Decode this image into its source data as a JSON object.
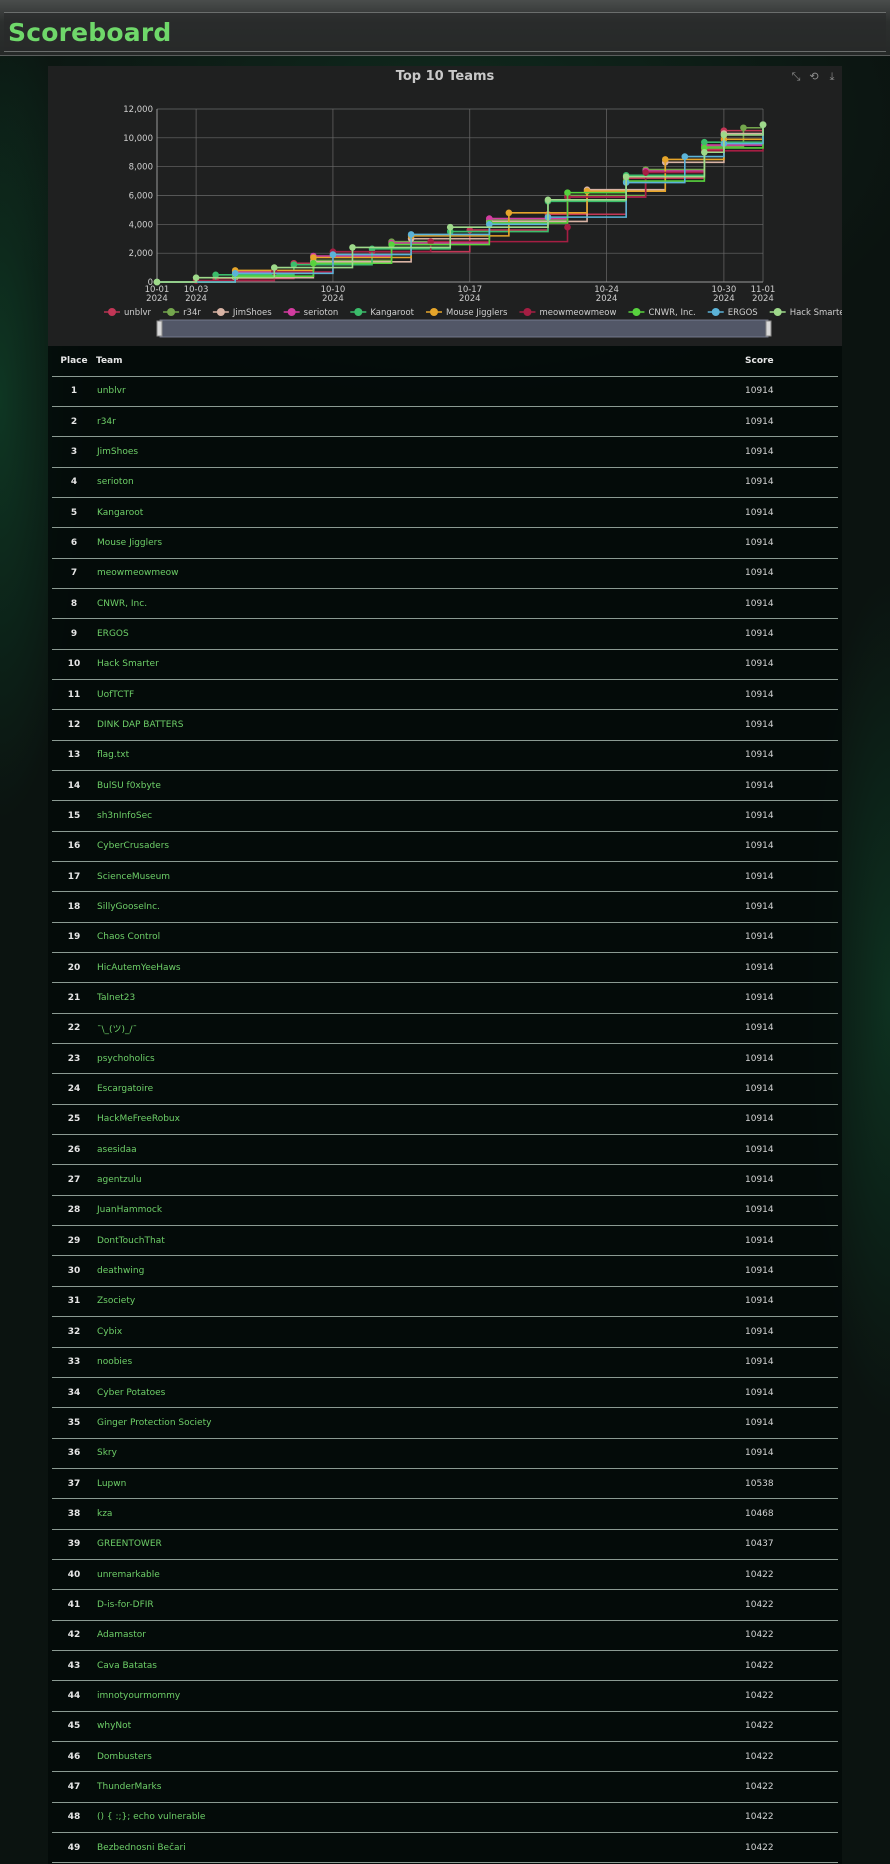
{
  "page": {
    "title": "Scoreboard"
  },
  "chart": {
    "title": "Top 10 Teams",
    "toolbox": [
      "zoom-icon",
      "zoom-reset-icon",
      "download-icon"
    ]
  },
  "chart_data": {
    "type": "line",
    "title": "Top 10 Teams",
    "xlabel": "",
    "ylabel": "",
    "x_ticks": [
      "10-01 2024",
      "10-03 2024",
      "10-10 2024",
      "10-17 2024",
      "10-24 2024",
      "10-30 2024",
      "11-01 2024"
    ],
    "y_ticks": [
      "0",
      "2,000",
      "4,000",
      "6,000",
      "8,000",
      "10,000",
      "12,000"
    ],
    "xlim": [
      "2024-10-01",
      "2024-11-01"
    ],
    "ylim": [
      0,
      12000
    ],
    "grid": true,
    "legend_position": "bottom",
    "series": [
      {
        "name": "unblvr",
        "color": "#c23656",
        "points": [
          [
            "2024-10-01",
            0
          ],
          [
            "2024-10-04",
            250
          ],
          [
            "2024-10-08",
            1300
          ],
          [
            "2024-10-12",
            2100
          ],
          [
            "2024-10-17",
            3600
          ],
          [
            "2024-10-21",
            4700
          ],
          [
            "2024-10-25",
            7200
          ],
          [
            "2024-10-29",
            9200
          ],
          [
            "2024-10-30",
            10500
          ],
          [
            "2024-11-01",
            10914
          ]
        ]
      },
      {
        "name": "r34r",
        "color": "#74a64d",
        "points": [
          [
            "2024-10-01",
            0
          ],
          [
            "2024-10-05",
            600
          ],
          [
            "2024-10-09",
            1500
          ],
          [
            "2024-10-13",
            2800
          ],
          [
            "2024-10-18",
            4300
          ],
          [
            "2024-10-22",
            6000
          ],
          [
            "2024-10-26",
            7800
          ],
          [
            "2024-10-29",
            9400
          ],
          [
            "2024-10-31",
            10700
          ],
          [
            "2024-11-01",
            10914
          ]
        ]
      },
      {
        "name": "JimShoes",
        "color": "#d8b3a4",
        "points": [
          [
            "2024-10-01",
            0
          ],
          [
            "2024-10-05",
            300
          ],
          [
            "2024-10-09",
            1400
          ],
          [
            "2024-10-14",
            3000
          ],
          [
            "2024-10-18",
            4200
          ],
          [
            "2024-10-23",
            6400
          ],
          [
            "2024-10-27",
            8300
          ],
          [
            "2024-10-30",
            10300
          ],
          [
            "2024-11-01",
            10914
          ]
        ]
      },
      {
        "name": "serioton",
        "color": "#d33ca0",
        "points": [
          [
            "2024-10-01",
            0
          ],
          [
            "2024-10-05",
            700
          ],
          [
            "2024-10-09",
            1800
          ],
          [
            "2024-10-13",
            2700
          ],
          [
            "2024-10-18",
            4400
          ],
          [
            "2024-10-22",
            5900
          ],
          [
            "2024-10-26",
            7700
          ],
          [
            "2024-10-29",
            9500
          ],
          [
            "2024-11-01",
            10914
          ]
        ]
      },
      {
        "name": "Kangaroot",
        "color": "#3bbd6b",
        "points": [
          [
            "2024-10-01",
            0
          ],
          [
            "2024-10-04",
            500
          ],
          [
            "2024-10-08",
            1200
          ],
          [
            "2024-10-12",
            2300
          ],
          [
            "2024-10-16",
            3500
          ],
          [
            "2024-10-21",
            5600
          ],
          [
            "2024-10-25",
            7400
          ],
          [
            "2024-10-29",
            9700
          ],
          [
            "2024-11-01",
            10914
          ]
        ]
      },
      {
        "name": "Mouse Jigglers",
        "color": "#e6a52a",
        "points": [
          [
            "2024-10-01",
            0
          ],
          [
            "2024-10-05",
            800
          ],
          [
            "2024-10-09",
            1700
          ],
          [
            "2024-10-14",
            3200
          ],
          [
            "2024-10-19",
            4800
          ],
          [
            "2024-10-23",
            6300
          ],
          [
            "2024-10-27",
            8500
          ],
          [
            "2024-10-30",
            9900
          ],
          [
            "2024-11-01",
            10914
          ]
        ]
      },
      {
        "name": "meowmeowmeow",
        "color": "#a51e43",
        "points": [
          [
            "2024-10-01",
            0
          ],
          [
            "2024-10-03",
            100
          ],
          [
            "2024-10-07",
            700
          ],
          [
            "2024-10-10",
            2100
          ],
          [
            "2024-10-15",
            2800
          ],
          [
            "2024-10-22",
            3800
          ],
          [
            "2024-10-22",
            5900
          ],
          [
            "2024-10-26",
            7600
          ],
          [
            "2024-10-29",
            9100
          ],
          [
            "2024-11-01",
            10914
          ]
        ]
      },
      {
        "name": "CNWR, Inc.",
        "color": "#58d23e",
        "points": [
          [
            "2024-10-01",
            0
          ],
          [
            "2024-10-05",
            400
          ],
          [
            "2024-10-09",
            1300
          ],
          [
            "2024-10-13",
            2600
          ],
          [
            "2024-10-18",
            4100
          ],
          [
            "2024-10-22",
            6200
          ],
          [
            "2024-10-25",
            7000
          ],
          [
            "2024-10-29",
            9300
          ],
          [
            "2024-11-01",
            10914
          ]
        ]
      },
      {
        "name": "ERGOS",
        "color": "#5bb3d8",
        "points": [
          [
            "2024-10-01",
            0
          ],
          [
            "2024-10-05",
            600
          ],
          [
            "2024-10-10",
            1900
          ],
          [
            "2024-10-14",
            3300
          ],
          [
            "2024-10-18",
            4000
          ],
          [
            "2024-10-21",
            4500
          ],
          [
            "2024-10-25",
            6900
          ],
          [
            "2024-10-28",
            8700
          ],
          [
            "2024-10-30",
            9600
          ],
          [
            "2024-11-01",
            10914
          ]
        ]
      },
      {
        "name": "Hack Smarter",
        "color": "#9ed98a",
        "points": [
          [
            "2024-10-01",
            0
          ],
          [
            "2024-10-03",
            300
          ],
          [
            "2024-10-07",
            1000
          ],
          [
            "2024-10-11",
            2400
          ],
          [
            "2024-10-16",
            3800
          ],
          [
            "2024-10-21",
            5700
          ],
          [
            "2024-10-25",
            7300
          ],
          [
            "2024-10-29",
            9000
          ],
          [
            "2024-10-30",
            10200
          ],
          [
            "2024-11-01",
            10914
          ]
        ]
      }
    ]
  },
  "table": {
    "headers": {
      "place": "Place",
      "team": "Team",
      "score": "Score"
    },
    "rows": [
      {
        "place": "1",
        "team": "unblvr",
        "score": "10914"
      },
      {
        "place": "2",
        "team": "r34r",
        "score": "10914"
      },
      {
        "place": "3",
        "team": "JimShoes",
        "score": "10914"
      },
      {
        "place": "4",
        "team": "serioton",
        "score": "10914"
      },
      {
        "place": "5",
        "team": "Kangaroot",
        "score": "10914"
      },
      {
        "place": "6",
        "team": "Mouse Jigglers",
        "score": "10914"
      },
      {
        "place": "7",
        "team": "meowmeowmeow",
        "score": "10914"
      },
      {
        "place": "8",
        "team": "CNWR, Inc.",
        "score": "10914"
      },
      {
        "place": "9",
        "team": "ERGOS",
        "score": "10914"
      },
      {
        "place": "10",
        "team": "Hack Smarter",
        "score": "10914"
      },
      {
        "place": "11",
        "team": "UofTCTF",
        "score": "10914"
      },
      {
        "place": "12",
        "team": "DINK DAP BATTERS",
        "score": "10914"
      },
      {
        "place": "13",
        "team": "flag.txt",
        "score": "10914"
      },
      {
        "place": "14",
        "team": "BulSU f0xbyte",
        "score": "10914"
      },
      {
        "place": "15",
        "team": "sh3nInfoSec",
        "score": "10914"
      },
      {
        "place": "16",
        "team": "CyberCrusaders",
        "score": "10914"
      },
      {
        "place": "17",
        "team": "ScienceMuseum",
        "score": "10914"
      },
      {
        "place": "18",
        "team": "SillyGooseInc.",
        "score": "10914"
      },
      {
        "place": "19",
        "team": "Chaos Control",
        "score": "10914"
      },
      {
        "place": "20",
        "team": "HicAutemYeeHaws",
        "score": "10914"
      },
      {
        "place": "21",
        "team": "Talnet23",
        "score": "10914"
      },
      {
        "place": "22",
        "team": "¯\\_(ツ)_/¯",
        "score": "10914"
      },
      {
        "place": "23",
        "team": "psychoholics",
        "score": "10914"
      },
      {
        "place": "24",
        "team": "Escargatoire",
        "score": "10914"
      },
      {
        "place": "25",
        "team": "HackMeFreeRobux",
        "score": "10914"
      },
      {
        "place": "26",
        "team": "asesidaa",
        "score": "10914"
      },
      {
        "place": "27",
        "team": "agentzulu",
        "score": "10914"
      },
      {
        "place": "28",
        "team": "JuanHammock",
        "score": "10914"
      },
      {
        "place": "29",
        "team": "DontTouchThat",
        "score": "10914"
      },
      {
        "place": "30",
        "team": "deathwing",
        "score": "10914"
      },
      {
        "place": "31",
        "team": "Zsociety",
        "score": "10914"
      },
      {
        "place": "32",
        "team": "Cybix",
        "score": "10914"
      },
      {
        "place": "33",
        "team": "noobies",
        "score": "10914"
      },
      {
        "place": "34",
        "team": "Cyber Potatoes",
        "score": "10914"
      },
      {
        "place": "35",
        "team": "Ginger Protection Society",
        "score": "10914"
      },
      {
        "place": "36",
        "team": "Skry",
        "score": "10914"
      },
      {
        "place": "37",
        "team": "Lupwn",
        "score": "10538"
      },
      {
        "place": "38",
        "team": "kza",
        "score": "10468"
      },
      {
        "place": "39",
        "team": "GREENTOWER",
        "score": "10437"
      },
      {
        "place": "40",
        "team": "unremarkable",
        "score": "10422"
      },
      {
        "place": "41",
        "team": "D-is-for-DFIR",
        "score": "10422"
      },
      {
        "place": "42",
        "team": "Adamastor",
        "score": "10422"
      },
      {
        "place": "43",
        "team": "Cava Batatas",
        "score": "10422"
      },
      {
        "place": "44",
        "team": "imnotyourmommy",
        "score": "10422"
      },
      {
        "place": "45",
        "team": "whyNot",
        "score": "10422"
      },
      {
        "place": "46",
        "team": "Dombusters",
        "score": "10422"
      },
      {
        "place": "47",
        "team": "ThunderMarks",
        "score": "10422"
      },
      {
        "place": "48",
        "team": "() { :;}; echo vulnerable",
        "score": "10422"
      },
      {
        "place": "49",
        "team": "Bezbednosni Bečari",
        "score": "10422"
      }
    ]
  }
}
